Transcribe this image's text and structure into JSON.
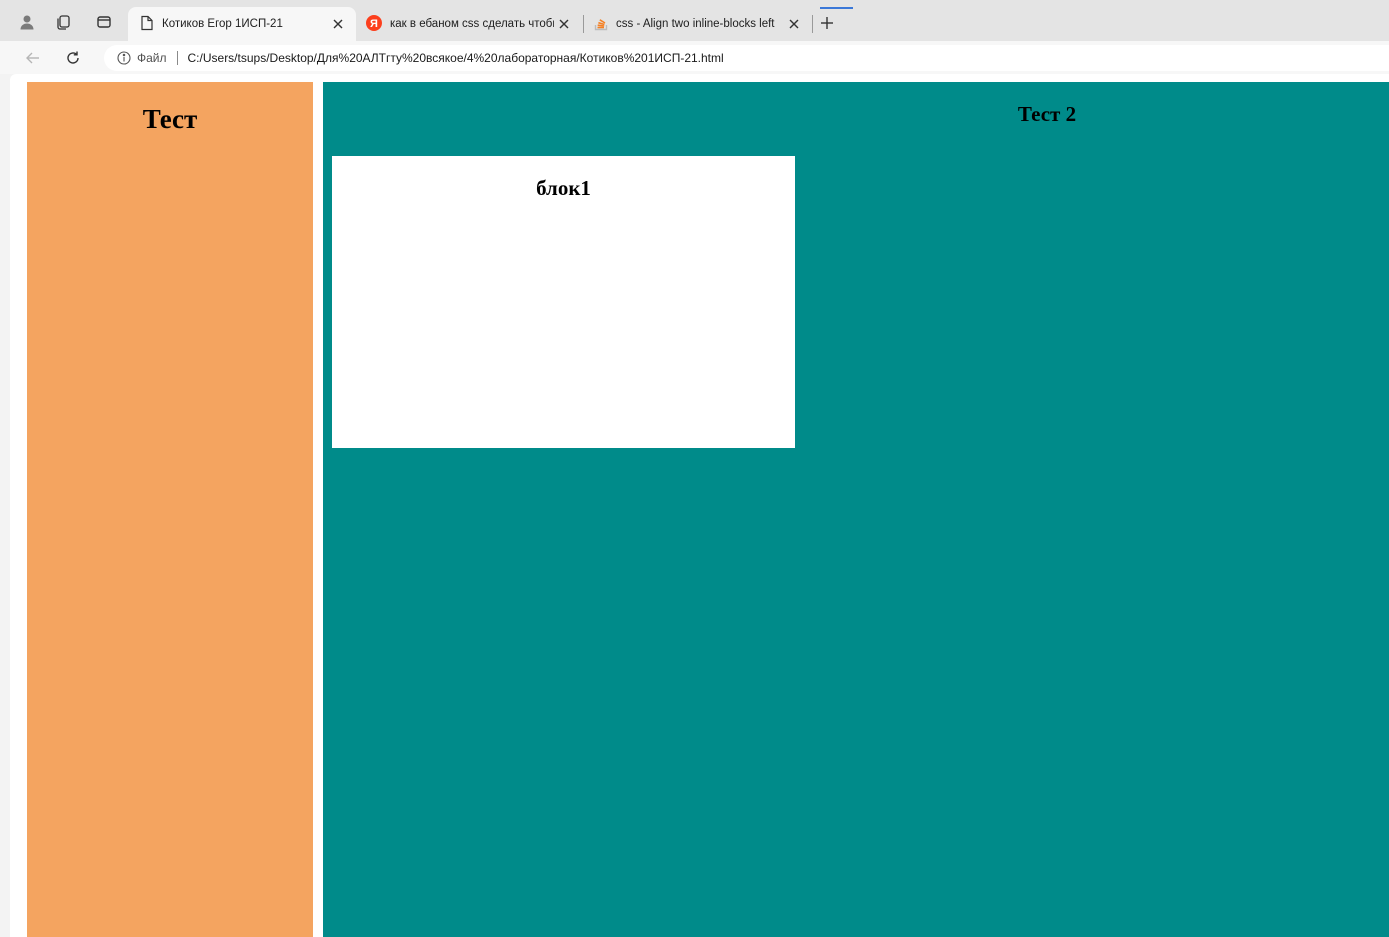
{
  "browser": {
    "tabs": [
      {
        "title": "Котиков Егор 1ИСП-21",
        "active": true,
        "icon": "page-icon"
      },
      {
        "title": "как в ебаном css сделать чтобы",
        "active": false,
        "icon": "yandex-icon"
      },
      {
        "title": "css - Align two inline-blocks left",
        "active": false,
        "icon": "stackoverflow-icon"
      }
    ],
    "address": {
      "scheme_label": "Файл",
      "url": "C:/Users/tsups/Desktop/Для%20АЛТгту%20всякое/4%20лабораторная/Котиков%201ИСП-21.html"
    },
    "colors": {
      "tabstrip": "#e4e4e4",
      "yandex": "#fc3f1d",
      "stackoverflow": "#f48024"
    }
  },
  "page": {
    "left_heading": "Тест",
    "right_heading": "Тест 2",
    "block_heading": "блок1",
    "colors": {
      "left_panel": "#f4a460",
      "right_panel": "#008b8a",
      "block": "#ffffff"
    }
  }
}
